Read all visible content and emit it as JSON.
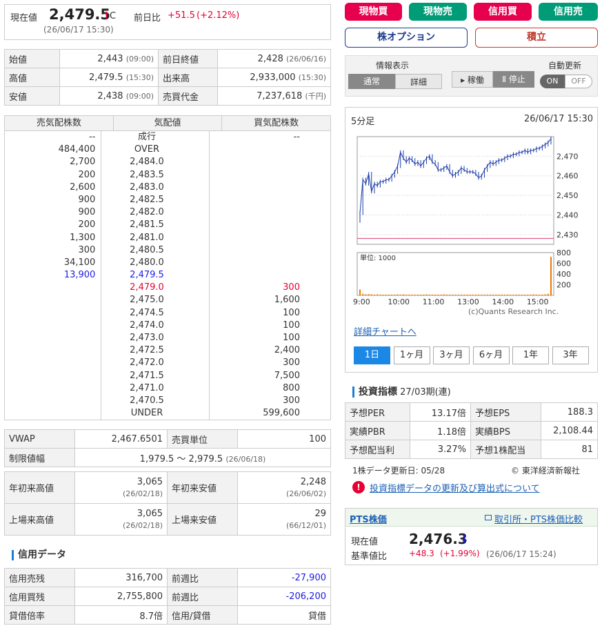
{
  "quote": {
    "label": "現在値",
    "price": "2,479.5",
    "arrow": "↑",
    "mark": "C",
    "change_label": "前日比",
    "change": "+51.5",
    "change_pct": "(+2.12%)",
    "time": "(26/06/17 15:30)"
  },
  "ohlc": [
    {
      "l1": "始値",
      "v1": "2,443",
      "t1": "(09:00)",
      "l2": "前日終値",
      "v2": "2,428",
      "t2": "(26/06/16)"
    },
    {
      "l1": "高値",
      "v1": "2,479.5",
      "t1": "(15:30)",
      "l2": "出来高",
      "v2": "2,933,000",
      "t2": "(15:30)"
    },
    {
      "l1": "安値",
      "v1": "2,438",
      "t1": "(09:00)",
      "l2": "売買代金",
      "v2": "7,237,618",
      "t2": "(千円)"
    }
  ],
  "orderbook": {
    "headers": [
      "売気配株数",
      "気配値",
      "買気配株数"
    ],
    "rows": [
      [
        "--",
        "成行",
        "--"
      ],
      [
        "484,400",
        "OVER",
        ""
      ],
      [
        "2,700",
        "2,484.0",
        ""
      ],
      [
        "200",
        "2,483.5",
        ""
      ],
      [
        "2,600",
        "2,483.0",
        ""
      ],
      [
        "900",
        "2,482.5",
        ""
      ],
      [
        "900",
        "2,482.0",
        ""
      ],
      [
        "200",
        "2,481.5",
        ""
      ],
      [
        "1,300",
        "2,481.0",
        ""
      ],
      [
        "300",
        "2,480.5",
        ""
      ],
      [
        "34,100",
        "2,480.0",
        ""
      ],
      [
        "13,900",
        "2,479.5",
        ""
      ],
      [
        "",
        "2,479.0",
        "300"
      ],
      [
        "",
        "2,475.0",
        "1,600"
      ],
      [
        "",
        "2,474.5",
        "100"
      ],
      [
        "",
        "2,474.0",
        "100"
      ],
      [
        "",
        "2,473.0",
        "100"
      ],
      [
        "",
        "2,472.5",
        "2,400"
      ],
      [
        "",
        "2,472.0",
        "300"
      ],
      [
        "",
        "2,471.5",
        "7,500"
      ],
      [
        "",
        "2,471.0",
        "800"
      ],
      [
        "",
        "2,470.5",
        "300"
      ],
      [
        "",
        "UNDER",
        "599,600"
      ]
    ]
  },
  "vwap": {
    "label": "VWAP",
    "value": "2,467.6501",
    "unit_label": "売買単位",
    "unit": "100",
    "limit_label": "制限値幅",
    "limit": "1,979.5 〜 2,979.5",
    "limit_date": "(26/06/18)"
  },
  "yearly": [
    {
      "l1": "年初来高値",
      "v1": "3,065",
      "d1": "(26/02/18)",
      "l2": "年初来安値",
      "v2": "2,248",
      "d2": "(26/06/02)"
    },
    {
      "l1": "上場来高値",
      "v1": "3,065",
      "d1": "(26/02/18)",
      "l2": "上場来安値",
      "v2": "29",
      "d2": "(66/12/01)"
    }
  ],
  "credit": {
    "title": "信用データ",
    "rows": [
      {
        "l1": "信用売残",
        "v1": "316,700",
        "l2": "前週比",
        "v2": "-27,900"
      },
      {
        "l1": "信用買残",
        "v1": "2,755,800",
        "l2": "前週比",
        "v2": "-206,200"
      },
      {
        "l1": "貸借倍率",
        "v1": "8.7倍",
        "l2": "信用/貸借",
        "v2": "貸借"
      }
    ]
  },
  "buttons": {
    "spot_buy": "現物買",
    "spot_sell": "現物売",
    "margin_buy": "信用買",
    "margin_sell": "信用売",
    "options": "株オプション",
    "savings": "積立"
  },
  "display": {
    "label": "情報表示",
    "normal": "通常",
    "detail": "詳細",
    "auto_label": "自動更新",
    "run": "▸ 稼働",
    "stop": "Ⅱ 停止",
    "on": "ON",
    "off": "OFF"
  },
  "chart": {
    "title": "5分足",
    "time": "26/06/17 15:30",
    "vol_label": "単位: 1000",
    "credit": "(c)Quants Research Inc.",
    "detail_link": "詳細チャートへ",
    "price_ticks": [
      "2,470",
      "2,460",
      "2,450",
      "2,440",
      "2,430"
    ],
    "vol_ticks": [
      "800",
      "600",
      "400",
      "200"
    ],
    "time_ticks": [
      "9:00",
      "10:00",
      "11:00",
      "13:00",
      "14:00",
      "15:00"
    ],
    "tabs": [
      "1日",
      "1ヶ月",
      "3ヶ月",
      "6ヶ月",
      "1年",
      "3年"
    ]
  },
  "chart_data": {
    "type": "line",
    "x": [
      "9:00",
      "9:05",
      "9:10",
      "9:15",
      "9:20",
      "9:25",
      "9:30",
      "9:35",
      "9:40",
      "9:45",
      "9:50",
      "9:55",
      "10:00",
      "10:05",
      "10:10",
      "10:15",
      "10:20",
      "10:25",
      "10:30",
      "10:35",
      "10:40",
      "10:45",
      "10:50",
      "10:55",
      "11:00",
      "11:05",
      "11:10",
      "11:15",
      "11:20",
      "11:25",
      "12:30",
      "12:35",
      "12:40",
      "12:45",
      "12:50",
      "12:55",
      "13:00",
      "13:05",
      "13:10",
      "13:15",
      "13:20",
      "13:25",
      "13:30",
      "13:35",
      "13:40",
      "13:45",
      "13:50",
      "13:55",
      "14:00",
      "14:05",
      "14:10",
      "14:15",
      "14:20",
      "14:25",
      "14:30",
      "14:35",
      "14:40",
      "14:45",
      "14:50",
      "14:55",
      "15:00",
      "15:05",
      "15:10",
      "15:15",
      "15:20",
      "15:25",
      "15:30"
    ],
    "close": [
      2441,
      2458,
      2456,
      2461,
      2452,
      2456,
      2455,
      2457,
      2457,
      2458,
      2458,
      2460,
      2462,
      2465,
      2472,
      2469,
      2467,
      2469,
      2468,
      2466,
      2467,
      2465,
      2467,
      2469,
      2470,
      2467,
      2466,
      2463,
      2463,
      2464,
      2465,
      2462,
      2460,
      2461,
      2462,
      2464,
      2463,
      2462,
      2462,
      2462,
      2461,
      2459,
      2460,
      2463,
      2465,
      2467,
      2466,
      2467,
      2468,
      2468,
      2469,
      2470,
      2470,
      2471,
      2471,
      2472,
      2472,
      2473,
      2472,
      2473,
      2473,
      2474,
      2474,
      2475,
      2476,
      2477,
      2479
    ],
    "volume_thousands": [
      110,
      30,
      20,
      25,
      20,
      15,
      20,
      15,
      15,
      15,
      15,
      15,
      15,
      20,
      15,
      20,
      15,
      15,
      15,
      15,
      15,
      15,
      15,
      20,
      15,
      15,
      15,
      15,
      15,
      20,
      15,
      15,
      15,
      15,
      15,
      15,
      15,
      15,
      15,
      15,
      15,
      15,
      15,
      15,
      15,
      15,
      15,
      15,
      15,
      15,
      15,
      15,
      15,
      15,
      15,
      15,
      15,
      15,
      15,
      15,
      20,
      15,
      15,
      15,
      20,
      30,
      720
    ],
    "prev_close": 2428,
    "ylim": [
      2425,
      2480
    ],
    "vol_ylim": [
      0,
      800
    ]
  },
  "indicators": {
    "title": "投資指標",
    "period": "27/03期(連)",
    "rows": [
      {
        "l1": "予想PER",
        "v1": "13.17倍",
        "l2": "予想EPS",
        "v2": "188.3"
      },
      {
        "l1": "実績PBR",
        "v1": "1.18倍",
        "l2": "実績BPS",
        "v2": "2,108.44"
      },
      {
        "l1": "予想配当利",
        "v1": "3.27%",
        "l2": "予想1株配当",
        "v2": "81"
      }
    ],
    "update": "1株データ更新日: 05/28",
    "source": "© 東洋経済新報社",
    "link": "投資指標データの更新及び算出式について"
  },
  "pts": {
    "title": "PTS株価",
    "link": "取引所・PTS株価比較",
    "price_label": "現在値",
    "price": "2,476.3",
    "arrow": "↓",
    "base_label": "基準値比",
    "change": "+48.3",
    "change_pct": "(+1.99%)",
    "time": "(26/06/17 15:24)"
  },
  "colors": {
    "buy": "#e6004d",
    "sell": "#009b77",
    "accent": "#1c88e6",
    "volume": "#f07800",
    "prev_line": "#e05b8c"
  }
}
